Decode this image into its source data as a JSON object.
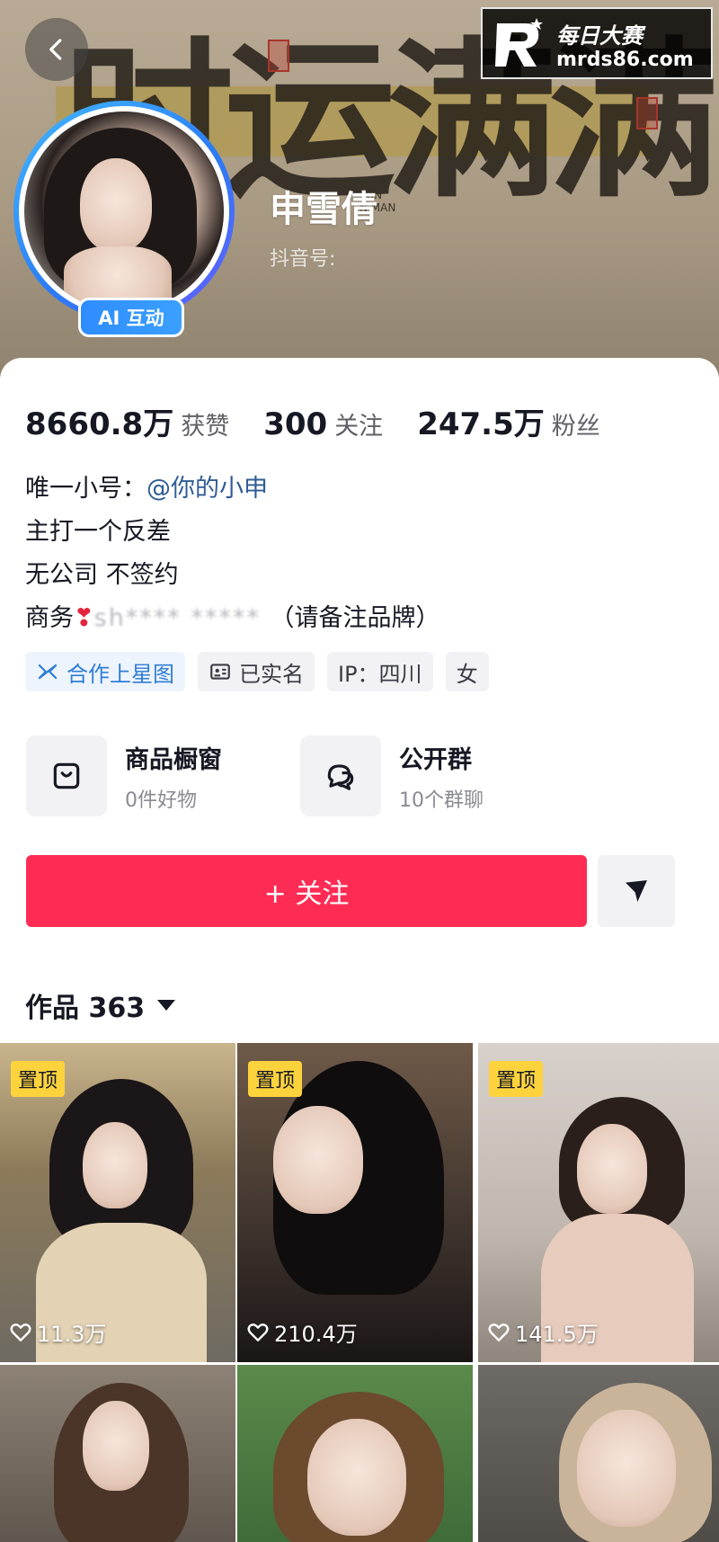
{
  "banner": {
    "calligraphy": "时运满满",
    "small_text": "YUN\nN MAN"
  },
  "watermark": {
    "line1": "每日大赛",
    "line2": "mrds86.com"
  },
  "profile": {
    "nickname": "申雪倩",
    "douyin_id_label": "抖音号:",
    "ai_badge": "AI 互动"
  },
  "stats": [
    {
      "value": "8660.8万",
      "label": "获赞"
    },
    {
      "value": "300",
      "label": "关注"
    },
    {
      "value": "247.5万",
      "label": "粉丝"
    }
  ],
  "bio": {
    "line1_prefix": "唯一小号：",
    "line1_mention": "@你的小申",
    "line2": "主打一个反差",
    "line3": "无公司 不签约",
    "line4_prefix": "商务",
    "line4_heart": "❣",
    "line4_blurred": "sh**** ***** ",
    "line4_suffix": "（请备注品牌）"
  },
  "tags": [
    {
      "label": "合作上星图",
      "icon": "xingtu-icon"
    },
    {
      "label": "已实名",
      "icon": "id-card-icon"
    },
    {
      "label": "IP：四川"
    },
    {
      "label": "女"
    }
  ],
  "features": [
    {
      "title": "商品橱窗",
      "sub": "0件好物",
      "icon": "shopping-bag-icon"
    },
    {
      "title": "公开群",
      "sub": "10个群聊",
      "icon": "group-chat-icon"
    }
  ],
  "follow_button": "+ 关注",
  "works": {
    "title": "作品 363"
  },
  "videos": [
    {
      "pinned": "置顶",
      "likes": "11.3万"
    },
    {
      "pinned": "置顶",
      "likes": "210.4万"
    },
    {
      "pinned": "置顶",
      "likes": "141.5万"
    },
    {
      "pinned": "",
      "likes": ""
    },
    {
      "pinned": "",
      "likes": ""
    },
    {
      "pinned": "",
      "likes": ""
    }
  ],
  "colors": {
    "accent": "#fe2c55",
    "link": "#2f5c95",
    "pin": "#fdd33d",
    "ai_badge": "#2f8cff"
  }
}
